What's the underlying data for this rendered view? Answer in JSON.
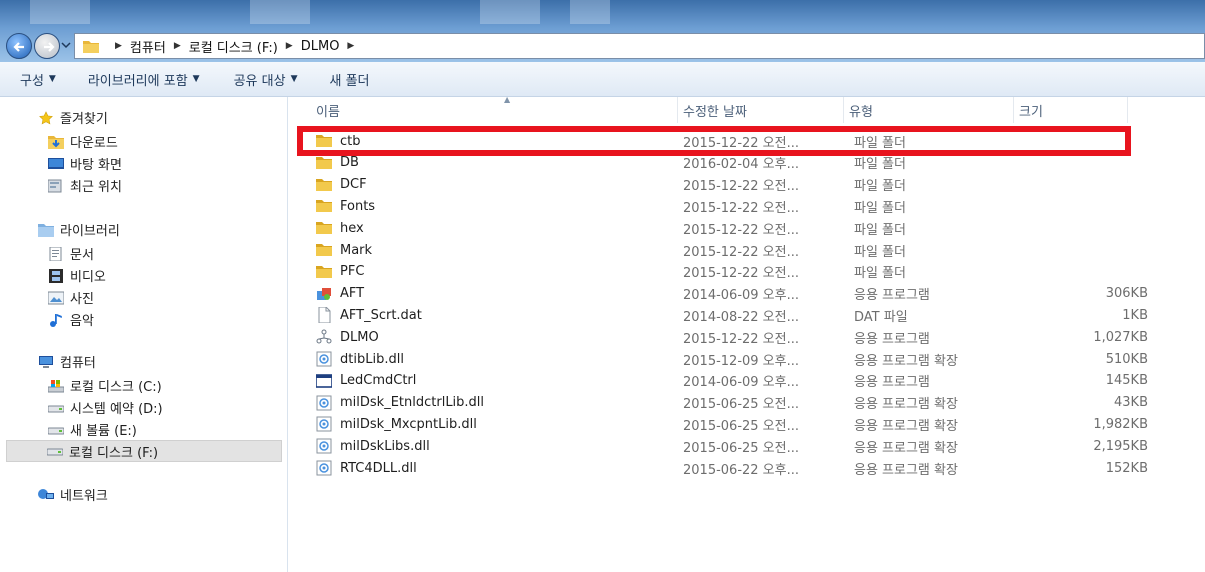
{
  "breadcrumb": [
    "컴퓨터",
    "로컬 디스크 (F:)",
    "DLMO"
  ],
  "toolbar": {
    "organize": "구성",
    "include_in_library": "라이브러리에 포함",
    "share_with": "공유 대상",
    "new_folder": "새 폴더"
  },
  "nav": {
    "favorites": "즐겨찾기",
    "downloads": "다운로드",
    "desktop": "바탕 화면",
    "recent_places": "최근 위치",
    "libraries": "라이브러리",
    "documents": "문서",
    "videos": "비디오",
    "pictures": "사진",
    "music": "음악",
    "computer": "컴퓨터",
    "drive_c": "로컬 디스크 (C:)",
    "drive_d": "시스템 예약 (D:)",
    "drive_e": "새 볼륨 (E:)",
    "drive_f": "로컬 디스크 (F:)",
    "network": "네트워크"
  },
  "columns": {
    "name": "이름",
    "date": "수정한 날짜",
    "type": "유형",
    "size": "크기"
  },
  "files": [
    {
      "name": "ctb",
      "date": "2015-12-22 오전...",
      "type": "파일 폴더",
      "size": "",
      "icon": "folder-icon"
    },
    {
      "name": "DB",
      "date": "2016-02-04 오후...",
      "type": "파일 폴더",
      "size": "",
      "icon": "folder-icon"
    },
    {
      "name": "DCF",
      "date": "2015-12-22 오전...",
      "type": "파일 폴더",
      "size": "",
      "icon": "folder-icon"
    },
    {
      "name": "Fonts",
      "date": "2015-12-22 오전...",
      "type": "파일 폴더",
      "size": "",
      "icon": "folder-icon"
    },
    {
      "name": "hex",
      "date": "2015-12-22 오전...",
      "type": "파일 폴더",
      "size": "",
      "icon": "folder-icon"
    },
    {
      "name": "Mark",
      "date": "2015-12-22 오전...",
      "type": "파일 폴더",
      "size": "",
      "icon": "folder-icon"
    },
    {
      "name": "PFC",
      "date": "2015-12-22 오전...",
      "type": "파일 폴더",
      "size": "",
      "icon": "folder-icon"
    },
    {
      "name": "AFT",
      "date": "2014-06-09 오후...",
      "type": "응용 프로그램",
      "size": "306KB",
      "icon": "application-icon"
    },
    {
      "name": "AFT_Scrt.dat",
      "date": "2014-08-22 오전...",
      "type": "DAT 파일",
      "size": "1KB",
      "icon": "file-icon"
    },
    {
      "name": "DLMO",
      "date": "2015-12-22 오전...",
      "type": "응용 프로그램",
      "size": "1,027KB",
      "icon": "network-app-icon"
    },
    {
      "name": "dtibLib.dll",
      "date": "2015-12-09 오후...",
      "type": "응용 프로그램 확장",
      "size": "510KB",
      "icon": "dll-icon"
    },
    {
      "name": "LedCmdCtrl",
      "date": "2014-06-09 오후...",
      "type": "응용 프로그램",
      "size": "145KB",
      "icon": "window-app-icon"
    },
    {
      "name": "milDsk_EtnldctrlLib.dll",
      "date": "2015-06-25 오전...",
      "type": "응용 프로그램 확장",
      "size": "43KB",
      "icon": "dll-icon"
    },
    {
      "name": "milDsk_MxcpntLib.dll",
      "date": "2015-06-25 오전...",
      "type": "응용 프로그램 확장",
      "size": "1,982KB",
      "icon": "dll-icon"
    },
    {
      "name": "milDskLibs.dll",
      "date": "2015-06-25 오전...",
      "type": "응용 프로그램 확장",
      "size": "2,195KB",
      "icon": "dll-icon"
    },
    {
      "name": "RTC4DLL.dll",
      "date": "2015-06-22 오후...",
      "type": "응용 프로그램 확장",
      "size": "152KB",
      "icon": "dll-icon"
    }
  ],
  "colors": {
    "highlight": "#e8141e",
    "folder": "#e9b73a",
    "addressbar": "#6d9ed3"
  }
}
